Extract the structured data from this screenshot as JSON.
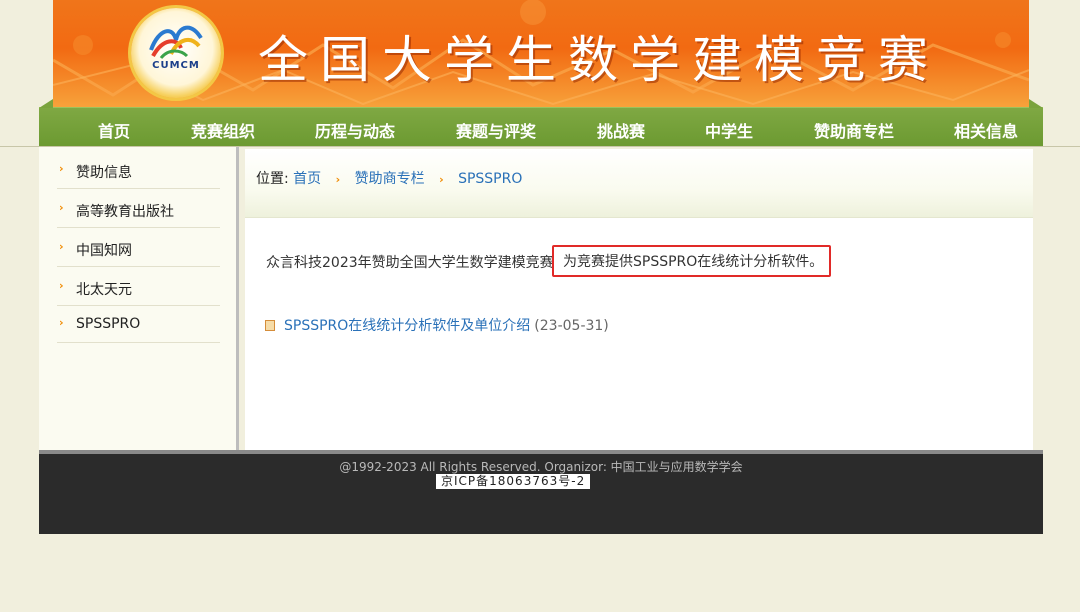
{
  "header": {
    "site_title": "全国大学生数学建模竞赛",
    "logo_text": "CUMCM"
  },
  "nav": {
    "items": [
      {
        "label": "首页"
      },
      {
        "label": "竞赛组织"
      },
      {
        "label": "历程与动态"
      },
      {
        "label": "赛题与评奖"
      },
      {
        "label": "挑战赛"
      },
      {
        "label": "中学生"
      },
      {
        "label": "赞助商专栏"
      },
      {
        "label": "相关信息"
      }
    ]
  },
  "sidebar": {
    "items": [
      {
        "label": "赞助信息"
      },
      {
        "label": "高等教育出版社"
      },
      {
        "label": "中国知网"
      },
      {
        "label": "北太天元"
      },
      {
        "label": "SPSSPRO"
      }
    ]
  },
  "breadcrumb": {
    "prefix": "位置:",
    "items": [
      {
        "label": "首页"
      },
      {
        "label": "赞助商专栏"
      },
      {
        "label": "SPSSPRO"
      }
    ]
  },
  "content": {
    "intro_text": "众言科技2023年赞助全国大学生数学建模竞赛",
    "intro_highlight": "为竞赛提供SPSSPRO在线统计分析软件。",
    "articles": [
      {
        "title": "SPSSPRO在线统计分析软件及单位介绍",
        "date": "(23-05-31)"
      }
    ]
  },
  "footer": {
    "copyright": "@1992-2023 All Rights Reserved.   Organizor: 中国工业与应用数学学会",
    "icp": "京ICP备18063763号-2"
  },
  "colors": {
    "banner": "#f26a12",
    "nav": "#6c9a31",
    "link": "#2a71b8",
    "highlight_border": "#e12a28",
    "footer": "#2b2b2b"
  }
}
